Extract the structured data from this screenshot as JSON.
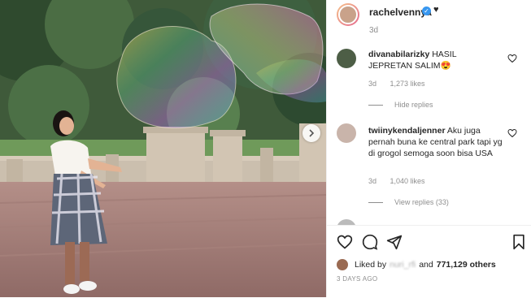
{
  "post": {
    "username": "rachelvennya",
    "verified_icon": "verified-badge-icon",
    "emoji": "♥",
    "time": "3d"
  },
  "comments": [
    {
      "username": "divanabilarizky",
      "text": "HASIL JEPRETAN SALIM😍",
      "time": "3d",
      "likes": "1,273 likes",
      "replies": "Hide replies"
    },
    {
      "username": "twiinykendaljenner",
      "text": "Aku juga pernah buna ke central park tapi yg di grogol semoga soon bisa USA",
      "time": "3d",
      "likes": "1,040 likes",
      "replies": "View replies (33)"
    }
  ],
  "footer": {
    "liked_prefix": "Liked by",
    "liked_user": "nuri_rfi",
    "liked_and": "and",
    "liked_count": "771,129 others",
    "posted": "3 DAYS AGO"
  },
  "colors": {
    "accent": "#3897f0",
    "text": "#262626",
    "muted": "#8e8e8e",
    "heart_emoji": "#e8433a"
  }
}
